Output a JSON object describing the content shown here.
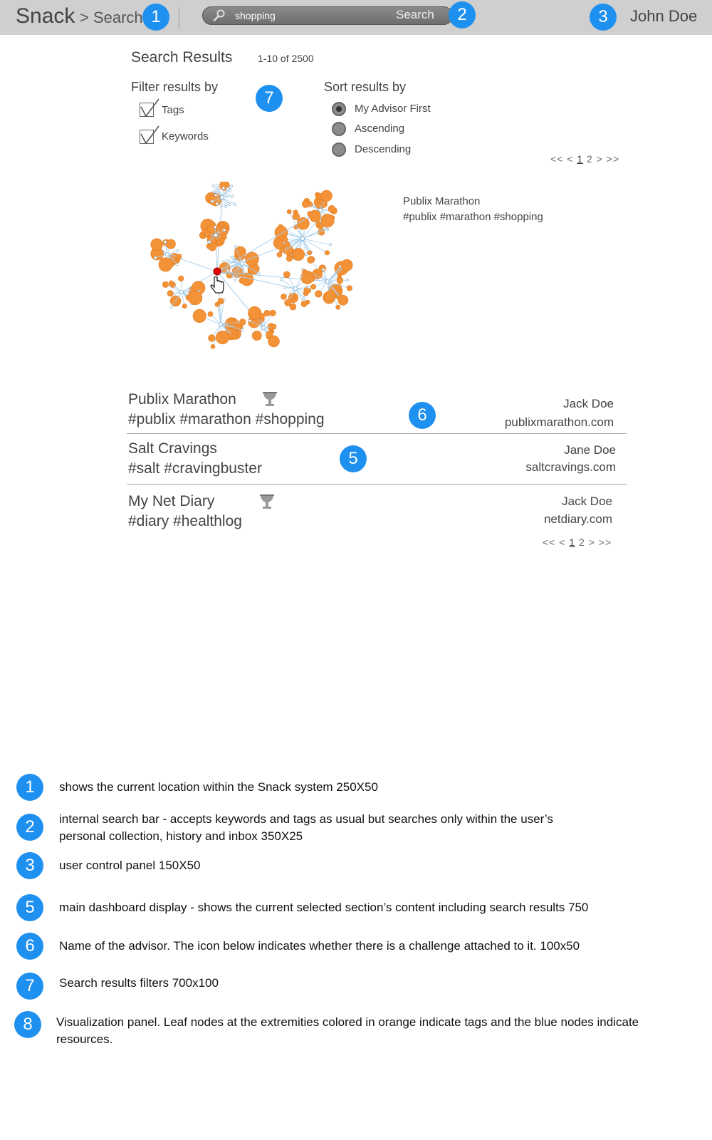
{
  "header": {
    "brand": "Snack",
    "breadcrumb": "> Search",
    "search": {
      "value": "shopping",
      "button_label": "Search"
    },
    "user_name": "John Doe"
  },
  "badges": {
    "b1": "1",
    "b2": "2",
    "b3": "3",
    "b5": "5",
    "b6": "6",
    "b7": "7",
    "b8": "8"
  },
  "results_header": {
    "title": "Search Results",
    "count": "1-10 of 2500"
  },
  "filters": {
    "title": "Filter results by",
    "items": [
      {
        "label": "Tags",
        "checked": true
      },
      {
        "label": "Keywords",
        "checked": true
      }
    ]
  },
  "sort": {
    "title": "Sort results by",
    "options": [
      {
        "label": "My Advisor First",
        "selected": true
      },
      {
        "label": "Ascending",
        "selected": false
      },
      {
        "label": "Descending",
        "selected": false
      }
    ]
  },
  "pagination": {
    "first": "<<",
    "prev": "<",
    "pages": [
      "1",
      "2"
    ],
    "current": "1",
    "next": ">",
    "last": ">>"
  },
  "visualization": {
    "tooltip_title": "Publix Marathon",
    "tooltip_tags": "#publix #marathon #shopping",
    "colors": {
      "tag_node": "#f39237",
      "resource_node": "#aad0ec",
      "selected_node": "#e00000"
    }
  },
  "results": [
    {
      "title": "Publix Marathon",
      "tags": "#publix #marathon #shopping",
      "advisor": "Jack Doe",
      "site": "publixmarathon.com",
      "challenge": true
    },
    {
      "title": "Salt Cravings",
      "tags": "#salt #cravingbuster",
      "advisor": "Jane Doe",
      "site": "saltcravings.com",
      "challenge": false
    },
    {
      "title": "My Net Diary",
      "tags": "#diary #healthlog",
      "advisor": "Jack Doe",
      "site": "netdiary.com",
      "challenge": true
    }
  ],
  "legend": [
    {
      "num": "1",
      "text": "shows the current location within the Snack system 250X50"
    },
    {
      "num": "2",
      "text": "internal search bar - accepts keywords and tags as usual but searches only within the user’s personal collection, history and inbox 350X25"
    },
    {
      "num": "3",
      "text": "user control panel 150X50"
    },
    {
      "num": "5",
      "text": "main dashboard display - shows the current selected section’s content including search results 750"
    },
    {
      "num": "6",
      "text": "Name of the advisor. The icon below indicates whether there is a challenge attached to it. 100x50"
    },
    {
      "num": "7",
      "text": "Search results filters 700x100"
    },
    {
      "num": "8",
      "text": "Visualization panel. Leaf nodes at the extremities colored in orange indicate tags and the blue nodes indicate resources."
    }
  ]
}
